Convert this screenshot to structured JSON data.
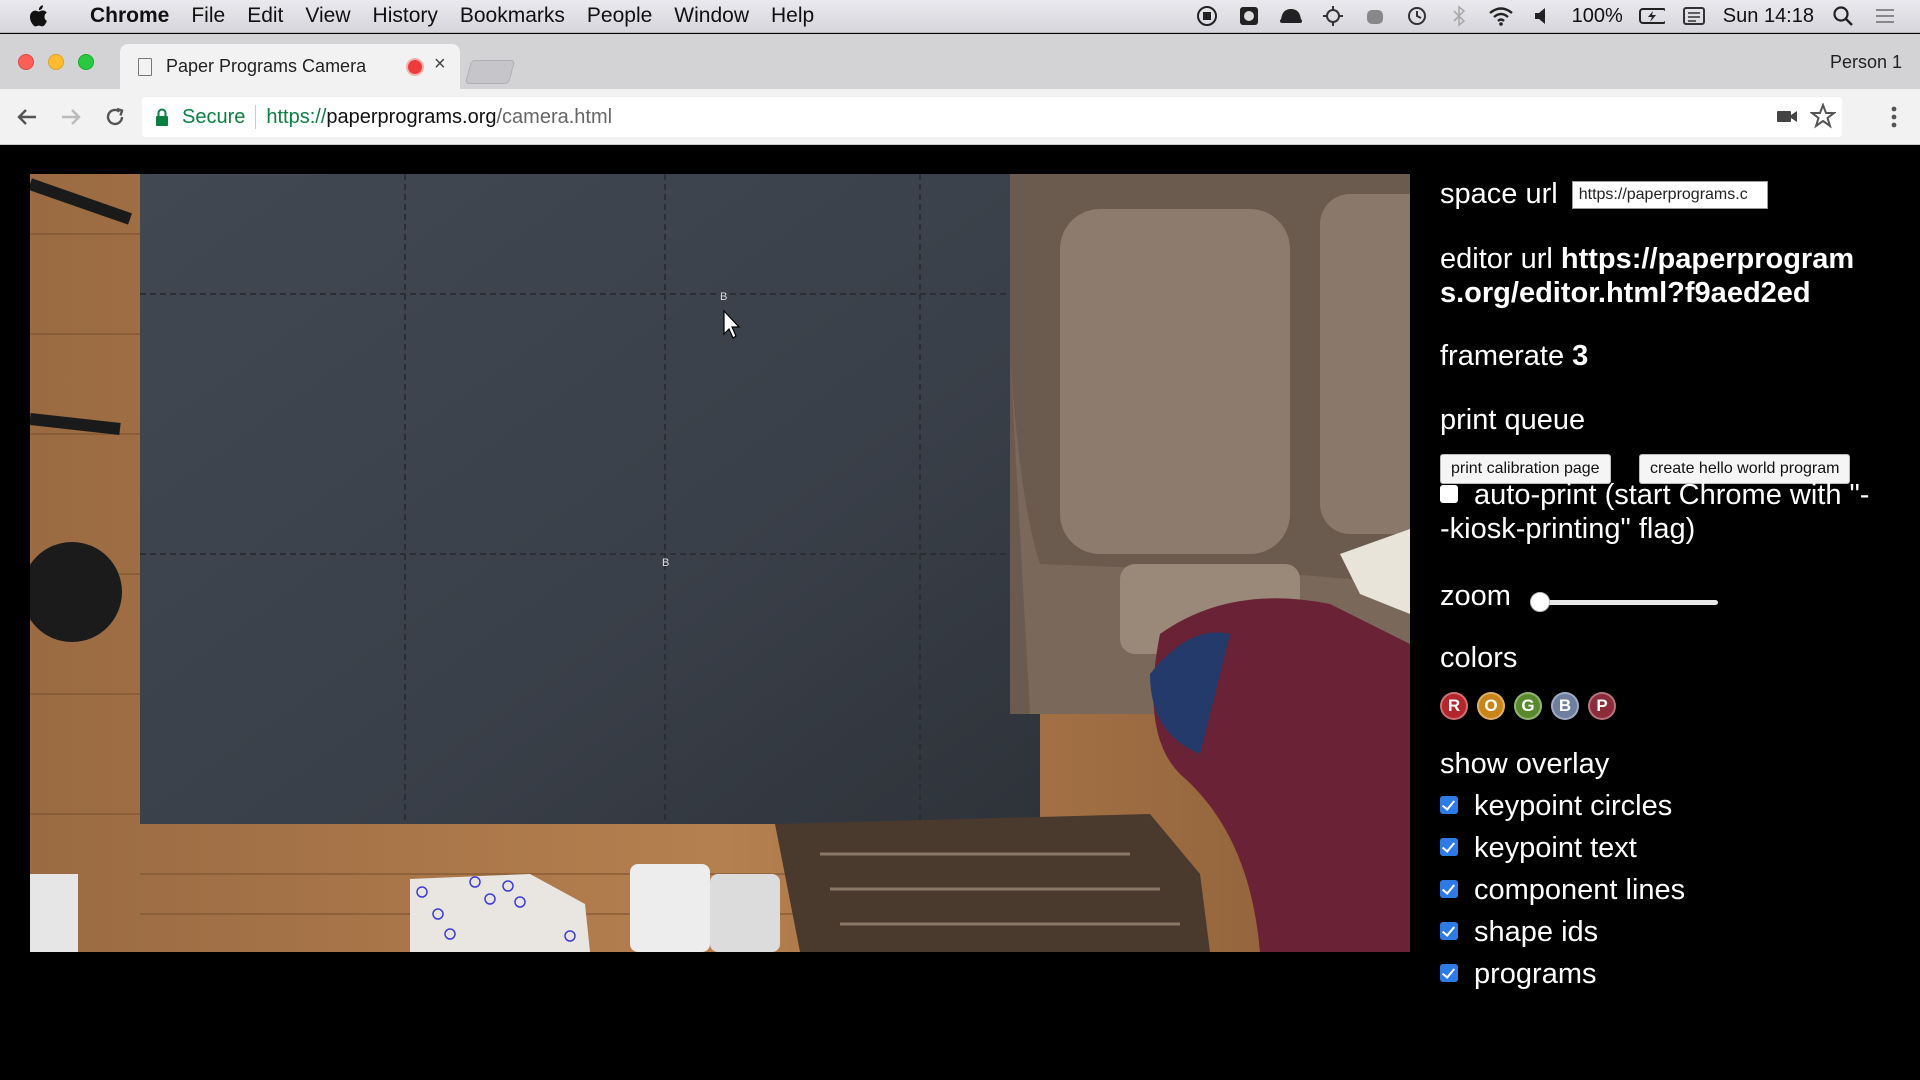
{
  "menubar": {
    "app_name": "Chrome",
    "items": [
      "File",
      "Edit",
      "View",
      "History",
      "Bookmarks",
      "People",
      "Window",
      "Help"
    ],
    "battery": "100%",
    "clock": "Sun 14:18"
  },
  "tabs": {
    "active_title": "Paper Programs Camera",
    "person": "Person 1"
  },
  "omnibox": {
    "secure_label": "Secure",
    "scheme": "https://",
    "host": "paperprograms.org",
    "path": "/camera.html"
  },
  "panel": {
    "space_url_label": "space url",
    "space_url_value": "https://paperprograms.c",
    "editor_url_label": "editor url",
    "editor_url_line1": "https://paperprogram",
    "editor_url_line2": "s.org/editor.html?f9aed2ed",
    "framerate_label": "framerate",
    "framerate_value": "3",
    "print_queue_label": "print queue",
    "print_calibration_button": "print calibration page",
    "create_hello_button": "create hello world program",
    "auto_print_line1": "auto-print (start Chrome with \"-",
    "auto_print_line2": "-kiosk-printing\" flag)",
    "auto_print_checked": false,
    "zoom_label": "zoom",
    "zoom_value": 0,
    "colors_label": "colors",
    "colors": [
      {
        "letter": "R",
        "hex": "#b3262c"
      },
      {
        "letter": "O",
        "hex": "#c8861a"
      },
      {
        "letter": "G",
        "hex": "#5b8a2e"
      },
      {
        "letter": "B",
        "hex": "#6e7fa0"
      },
      {
        "letter": "P",
        "hex": "#8c2b3a"
      }
    ],
    "show_overlay_label": "show overlay",
    "overlay_options": [
      {
        "label": "keypoint circles",
        "checked": true
      },
      {
        "label": "keypoint text",
        "checked": true
      },
      {
        "label": "component lines",
        "checked": true
      },
      {
        "label": "shape ids",
        "checked": true
      },
      {
        "label": "programs",
        "checked": true
      }
    ]
  },
  "camera": {
    "marker_labels": [
      "B",
      "B"
    ]
  }
}
